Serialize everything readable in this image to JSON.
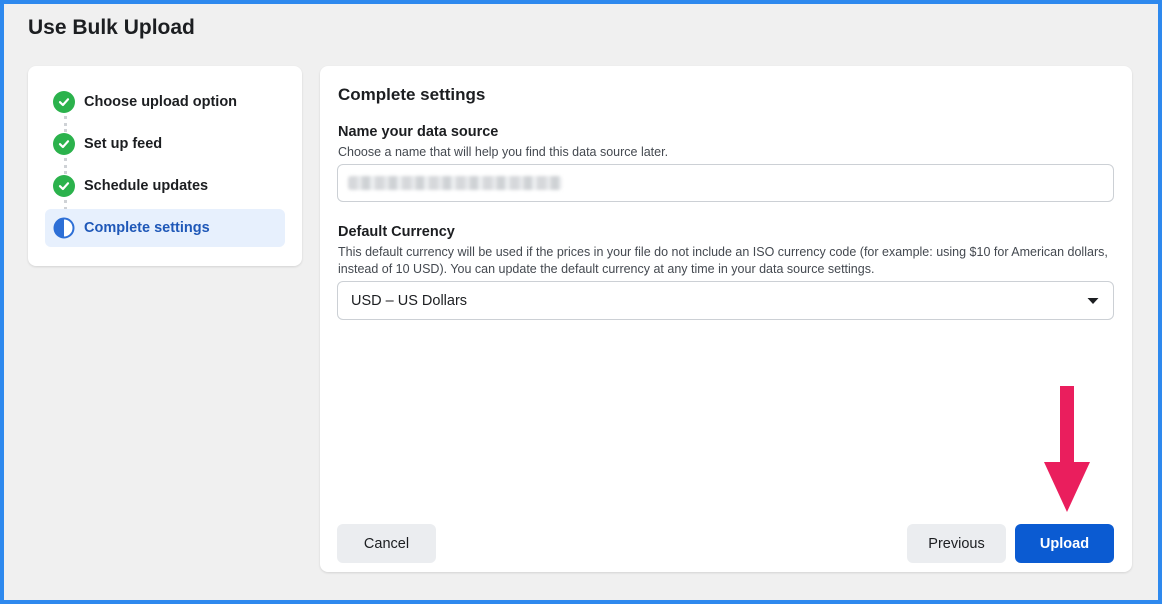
{
  "page": {
    "title": "Use Bulk Upload"
  },
  "steps": [
    {
      "label": "Choose upload option",
      "status": "complete",
      "icon": "check-circle-icon"
    },
    {
      "label": "Set up feed",
      "status": "complete",
      "icon": "check-circle-icon"
    },
    {
      "label": "Schedule updates",
      "status": "complete",
      "icon": "check-circle-icon"
    },
    {
      "label": "Complete settings",
      "status": "in-progress",
      "icon": "half-circle-icon"
    }
  ],
  "form": {
    "title": "Complete settings",
    "data_source": {
      "label": "Name your data source",
      "help": "Choose a name that will help you find this data source later."
    },
    "currency": {
      "label": "Default Currency",
      "help": "This default currency will be used if the prices in your file do not include an ISO currency code (for example: using $10 for American dollars, instead of 10 USD). You can update the default currency at any time in your data source settings.",
      "selected": "USD – US Dollars"
    }
  },
  "buttons": {
    "cancel": "Cancel",
    "previous": "Previous",
    "upload": "Upload"
  },
  "colors": {
    "accent": "#0b5bd2",
    "check_green": "#2bb24c",
    "active_step_bg": "#e7f0fd",
    "annotation_arrow": "#ea1e5d",
    "frame_border": "#2e89ee"
  }
}
